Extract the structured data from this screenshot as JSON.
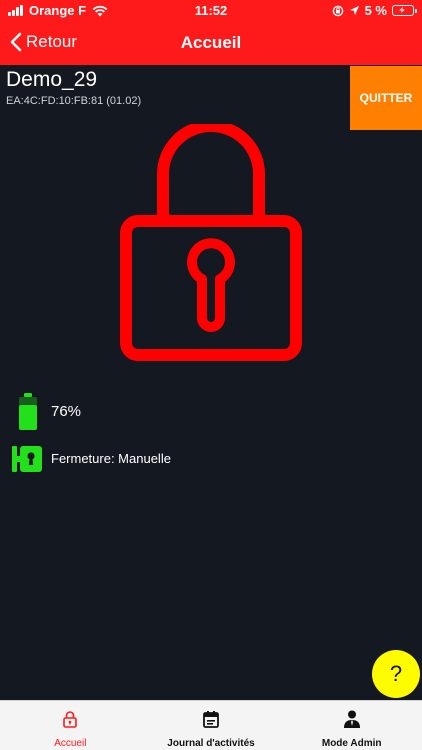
{
  "status_bar": {
    "carrier": "Orange F",
    "time": "11:52",
    "battery_text": "5 %"
  },
  "nav": {
    "back_label": "Retour",
    "title": "Accueil"
  },
  "device": {
    "name": "Demo_29",
    "mac": "EA:4C:FD:10:FB:81 (01.02)",
    "quit_label": "QUITTER"
  },
  "status": {
    "battery_level": "76%",
    "closing_mode": "Fermeture: Manuelle"
  },
  "help": {
    "label": "?"
  },
  "tabs": [
    {
      "label": "Accueil",
      "icon": "lock-icon",
      "active": true
    },
    {
      "label": "Journal d'activités",
      "icon": "calendar-icon",
      "active": false
    },
    {
      "label": "Mode Admin",
      "icon": "admin-user-icon",
      "active": false
    }
  ],
  "colors": {
    "header": "#fe1a1a",
    "background": "#141820",
    "quit_button": "#ff7f00",
    "status_green": "#22e01a",
    "help_button": "#fffc00"
  }
}
